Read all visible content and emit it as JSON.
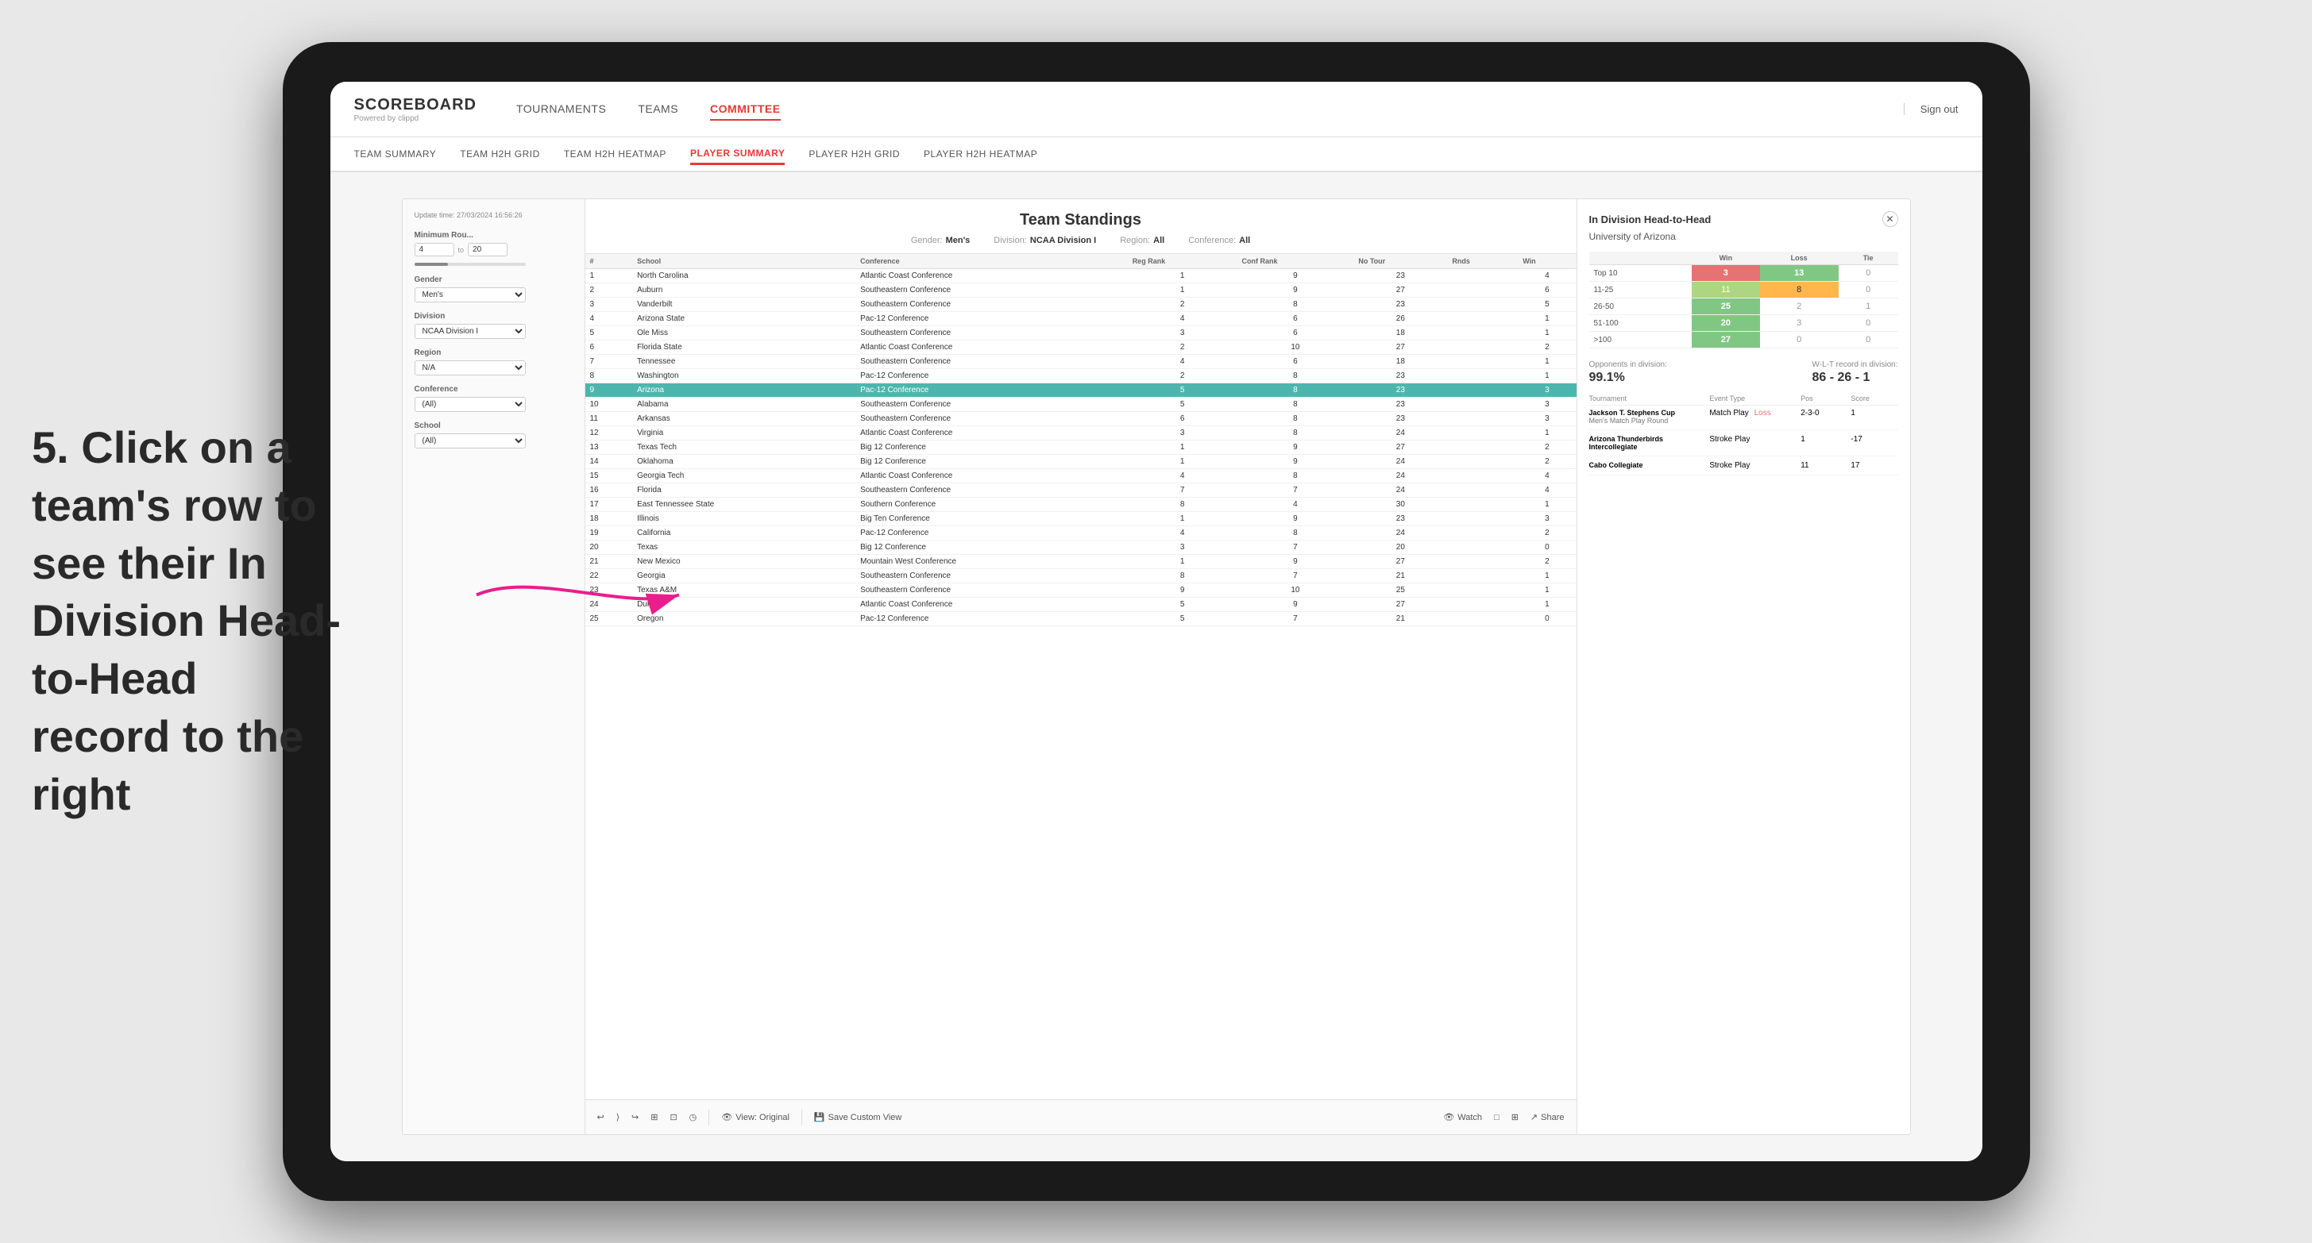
{
  "annotation": {
    "text": "5. Click on a team's row to see their In Division Head-to-Head record to the right"
  },
  "nav": {
    "logo": "SCOREBOARD",
    "logo_sub": "Powered by clippd",
    "items": [
      "TOURNAMENTS",
      "TEAMS",
      "COMMITTEE"
    ],
    "active_item": "COMMITTEE",
    "sign_out": "Sign out"
  },
  "sub_nav": {
    "items": [
      "TEAM SUMMARY",
      "TEAM H2H GRID",
      "TEAM H2H HEATMAP",
      "PLAYER SUMMARY",
      "PLAYER H2H GRID",
      "PLAYER H2H HEATMAP"
    ],
    "active_item": "PLAYER SUMMARY"
  },
  "update_time": "Update time: 27/03/2024 16:56:26",
  "filters": {
    "min_rounds_label": "Minimum Rou...",
    "min_rounds_value": "4",
    "max_rounds_value": "20",
    "gender_label": "Gender",
    "gender_value": "Men's",
    "division_label": "Division",
    "division_value": "NCAA Division I",
    "region_label": "Region",
    "region_value": "N/A",
    "conference_label": "Conference",
    "conference_value": "(All)",
    "school_label": "School",
    "school_value": "(All)"
  },
  "table": {
    "title": "Team Standings",
    "gender_label": "Gender:",
    "gender_value": "Men's",
    "division_label": "Division:",
    "division_value": "NCAA Division I",
    "region_label": "Region:",
    "region_value": "All",
    "conference_label": "Conference:",
    "conference_value": "All",
    "columns": [
      "#",
      "School",
      "Conference",
      "Reg Rank",
      "Conf Rank",
      "No Tour",
      "Rnds",
      "Win"
    ],
    "rows": [
      {
        "rank": 1,
        "school": "North Carolina",
        "conference": "Atlantic Coast Conference",
        "reg_rank": 1,
        "conf_rank": 9,
        "no_tour": 23,
        "rnds": "",
        "win": 4
      },
      {
        "rank": 2,
        "school": "Auburn",
        "conference": "Southeastern Conference",
        "reg_rank": 1,
        "conf_rank": 9,
        "no_tour": 27,
        "rnds": "",
        "win": 6
      },
      {
        "rank": 3,
        "school": "Vanderbilt",
        "conference": "Southeastern Conference",
        "reg_rank": 2,
        "conf_rank": 8,
        "no_tour": 23,
        "rnds": "",
        "win": 5
      },
      {
        "rank": 4,
        "school": "Arizona State",
        "conference": "Pac-12 Conference",
        "reg_rank": 4,
        "conf_rank": 6,
        "no_tour": 26,
        "rnds": "",
        "win": 1
      },
      {
        "rank": 5,
        "school": "Ole Miss",
        "conference": "Southeastern Conference",
        "reg_rank": 3,
        "conf_rank": 6,
        "no_tour": 18,
        "rnds": "",
        "win": 1
      },
      {
        "rank": 6,
        "school": "Florida State",
        "conference": "Atlantic Coast Conference",
        "reg_rank": 2,
        "conf_rank": 10,
        "no_tour": 27,
        "rnds": "",
        "win": 2
      },
      {
        "rank": 7,
        "school": "Tennessee",
        "conference": "Southeastern Conference",
        "reg_rank": 4,
        "conf_rank": 6,
        "no_tour": 18,
        "rnds": "",
        "win": 1
      },
      {
        "rank": 8,
        "school": "Washington",
        "conference": "Pac-12 Conference",
        "reg_rank": 2,
        "conf_rank": 8,
        "no_tour": 23,
        "rnds": "",
        "win": 1
      },
      {
        "rank": 9,
        "school": "Arizona",
        "conference": "Pac-12 Conference",
        "reg_rank": 5,
        "conf_rank": 8,
        "no_tour": 23,
        "rnds": "",
        "win": 3,
        "selected": true
      },
      {
        "rank": 10,
        "school": "Alabama",
        "conference": "Southeastern Conference",
        "reg_rank": 5,
        "conf_rank": 8,
        "no_tour": 23,
        "rnds": "",
        "win": 3
      },
      {
        "rank": 11,
        "school": "Arkansas",
        "conference": "Southeastern Conference",
        "reg_rank": 6,
        "conf_rank": 8,
        "no_tour": 23,
        "rnds": "",
        "win": 3
      },
      {
        "rank": 12,
        "school": "Virginia",
        "conference": "Atlantic Coast Conference",
        "reg_rank": 3,
        "conf_rank": 8,
        "no_tour": 24,
        "rnds": "",
        "win": 1
      },
      {
        "rank": 13,
        "school": "Texas Tech",
        "conference": "Big 12 Conference",
        "reg_rank": 1,
        "conf_rank": 9,
        "no_tour": 27,
        "rnds": "",
        "win": 2
      },
      {
        "rank": 14,
        "school": "Oklahoma",
        "conference": "Big 12 Conference",
        "reg_rank": 1,
        "conf_rank": 9,
        "no_tour": 24,
        "rnds": "",
        "win": 2
      },
      {
        "rank": 15,
        "school": "Georgia Tech",
        "conference": "Atlantic Coast Conference",
        "reg_rank": 4,
        "conf_rank": 8,
        "no_tour": 24,
        "rnds": "",
        "win": 4
      },
      {
        "rank": 16,
        "school": "Florida",
        "conference": "Southeastern Conference",
        "reg_rank": 7,
        "conf_rank": 7,
        "no_tour": 24,
        "rnds": "",
        "win": 4
      },
      {
        "rank": 17,
        "school": "East Tennessee State",
        "conference": "Southern Conference",
        "reg_rank": 8,
        "conf_rank": 4,
        "no_tour": 30,
        "rnds": "",
        "win": 1
      },
      {
        "rank": 18,
        "school": "Illinois",
        "conference": "Big Ten Conference",
        "reg_rank": 1,
        "conf_rank": 9,
        "no_tour": 23,
        "rnds": "",
        "win": 3
      },
      {
        "rank": 19,
        "school": "California",
        "conference": "Pac-12 Conference",
        "reg_rank": 4,
        "conf_rank": 8,
        "no_tour": 24,
        "rnds": "",
        "win": 2
      },
      {
        "rank": 20,
        "school": "Texas",
        "conference": "Big 12 Conference",
        "reg_rank": 3,
        "conf_rank": 7,
        "no_tour": 20,
        "rnds": "",
        "win": 0
      },
      {
        "rank": 21,
        "school": "New Mexico",
        "conference": "Mountain West Conference",
        "reg_rank": 1,
        "conf_rank": 9,
        "no_tour": 27,
        "rnds": "",
        "win": 2
      },
      {
        "rank": 22,
        "school": "Georgia",
        "conference": "Southeastern Conference",
        "reg_rank": 8,
        "conf_rank": 7,
        "no_tour": 21,
        "rnds": "",
        "win": 1
      },
      {
        "rank": 23,
        "school": "Texas A&M",
        "conference": "Southeastern Conference",
        "reg_rank": 9,
        "conf_rank": 10,
        "no_tour": 25,
        "rnds": "",
        "win": 1
      },
      {
        "rank": 24,
        "school": "Duke",
        "conference": "Atlantic Coast Conference",
        "reg_rank": 5,
        "conf_rank": 9,
        "no_tour": 27,
        "rnds": "",
        "win": 1
      },
      {
        "rank": 25,
        "school": "Oregon",
        "conference": "Pac-12 Conference",
        "reg_rank": 5,
        "conf_rank": 7,
        "no_tour": 21,
        "rnds": "",
        "win": 0
      }
    ]
  },
  "h2h": {
    "title": "In Division Head-to-Head",
    "team": "University of Arizona",
    "headers": [
      "",
      "Win",
      "Loss",
      "Tie"
    ],
    "rows": [
      {
        "label": "Top 10",
        "win": 3,
        "loss": 13,
        "tie": 0
      },
      {
        "label": "11-25",
        "win": 11,
        "loss": 8,
        "tie": 0
      },
      {
        "label": "26-50",
        "win": 25,
        "loss": 2,
        "tie": 1
      },
      {
        "label": "51-100",
        "win": 20,
        "loss": 3,
        "tie": 0
      },
      {
        "label": ">100",
        "win": 27,
        "loss": 0,
        "tie": 0
      }
    ],
    "opponents_label": "Opponents in division:",
    "opponents_value": "99.1%",
    "wlt_label": "W-L-T record in division:",
    "wlt_value": "86 - 26 - 1",
    "tournament_label": "Tournament",
    "event_type_label": "Event Type",
    "pos_label": "Pos",
    "score_label": "Score",
    "tournaments": [
      {
        "name": "Jackson T. Stephens Cup",
        "sub": "Men's Match Play Round",
        "event_type": "Match Play",
        "result": "Loss",
        "pos": "2-3-0",
        "score": "1"
      },
      {
        "name": "Arizona Thunderbirds Intercollegiate",
        "sub": "",
        "event_type": "Stroke Play",
        "result": "",
        "pos": "1",
        "score": "-17"
      },
      {
        "name": "Cabo Collegiate",
        "sub": "",
        "event_type": "Stroke Play",
        "result": "",
        "pos": "11",
        "score": "17"
      }
    ]
  },
  "toolbar": {
    "buttons": [
      "↩",
      "⟩",
      "↪",
      "⊞",
      "⊡",
      "◷"
    ],
    "view_original": "View: Original",
    "save_custom": "Save Custom View",
    "watch": "Watch",
    "icons_right": [
      "□",
      "⊞",
      "Share"
    ]
  }
}
